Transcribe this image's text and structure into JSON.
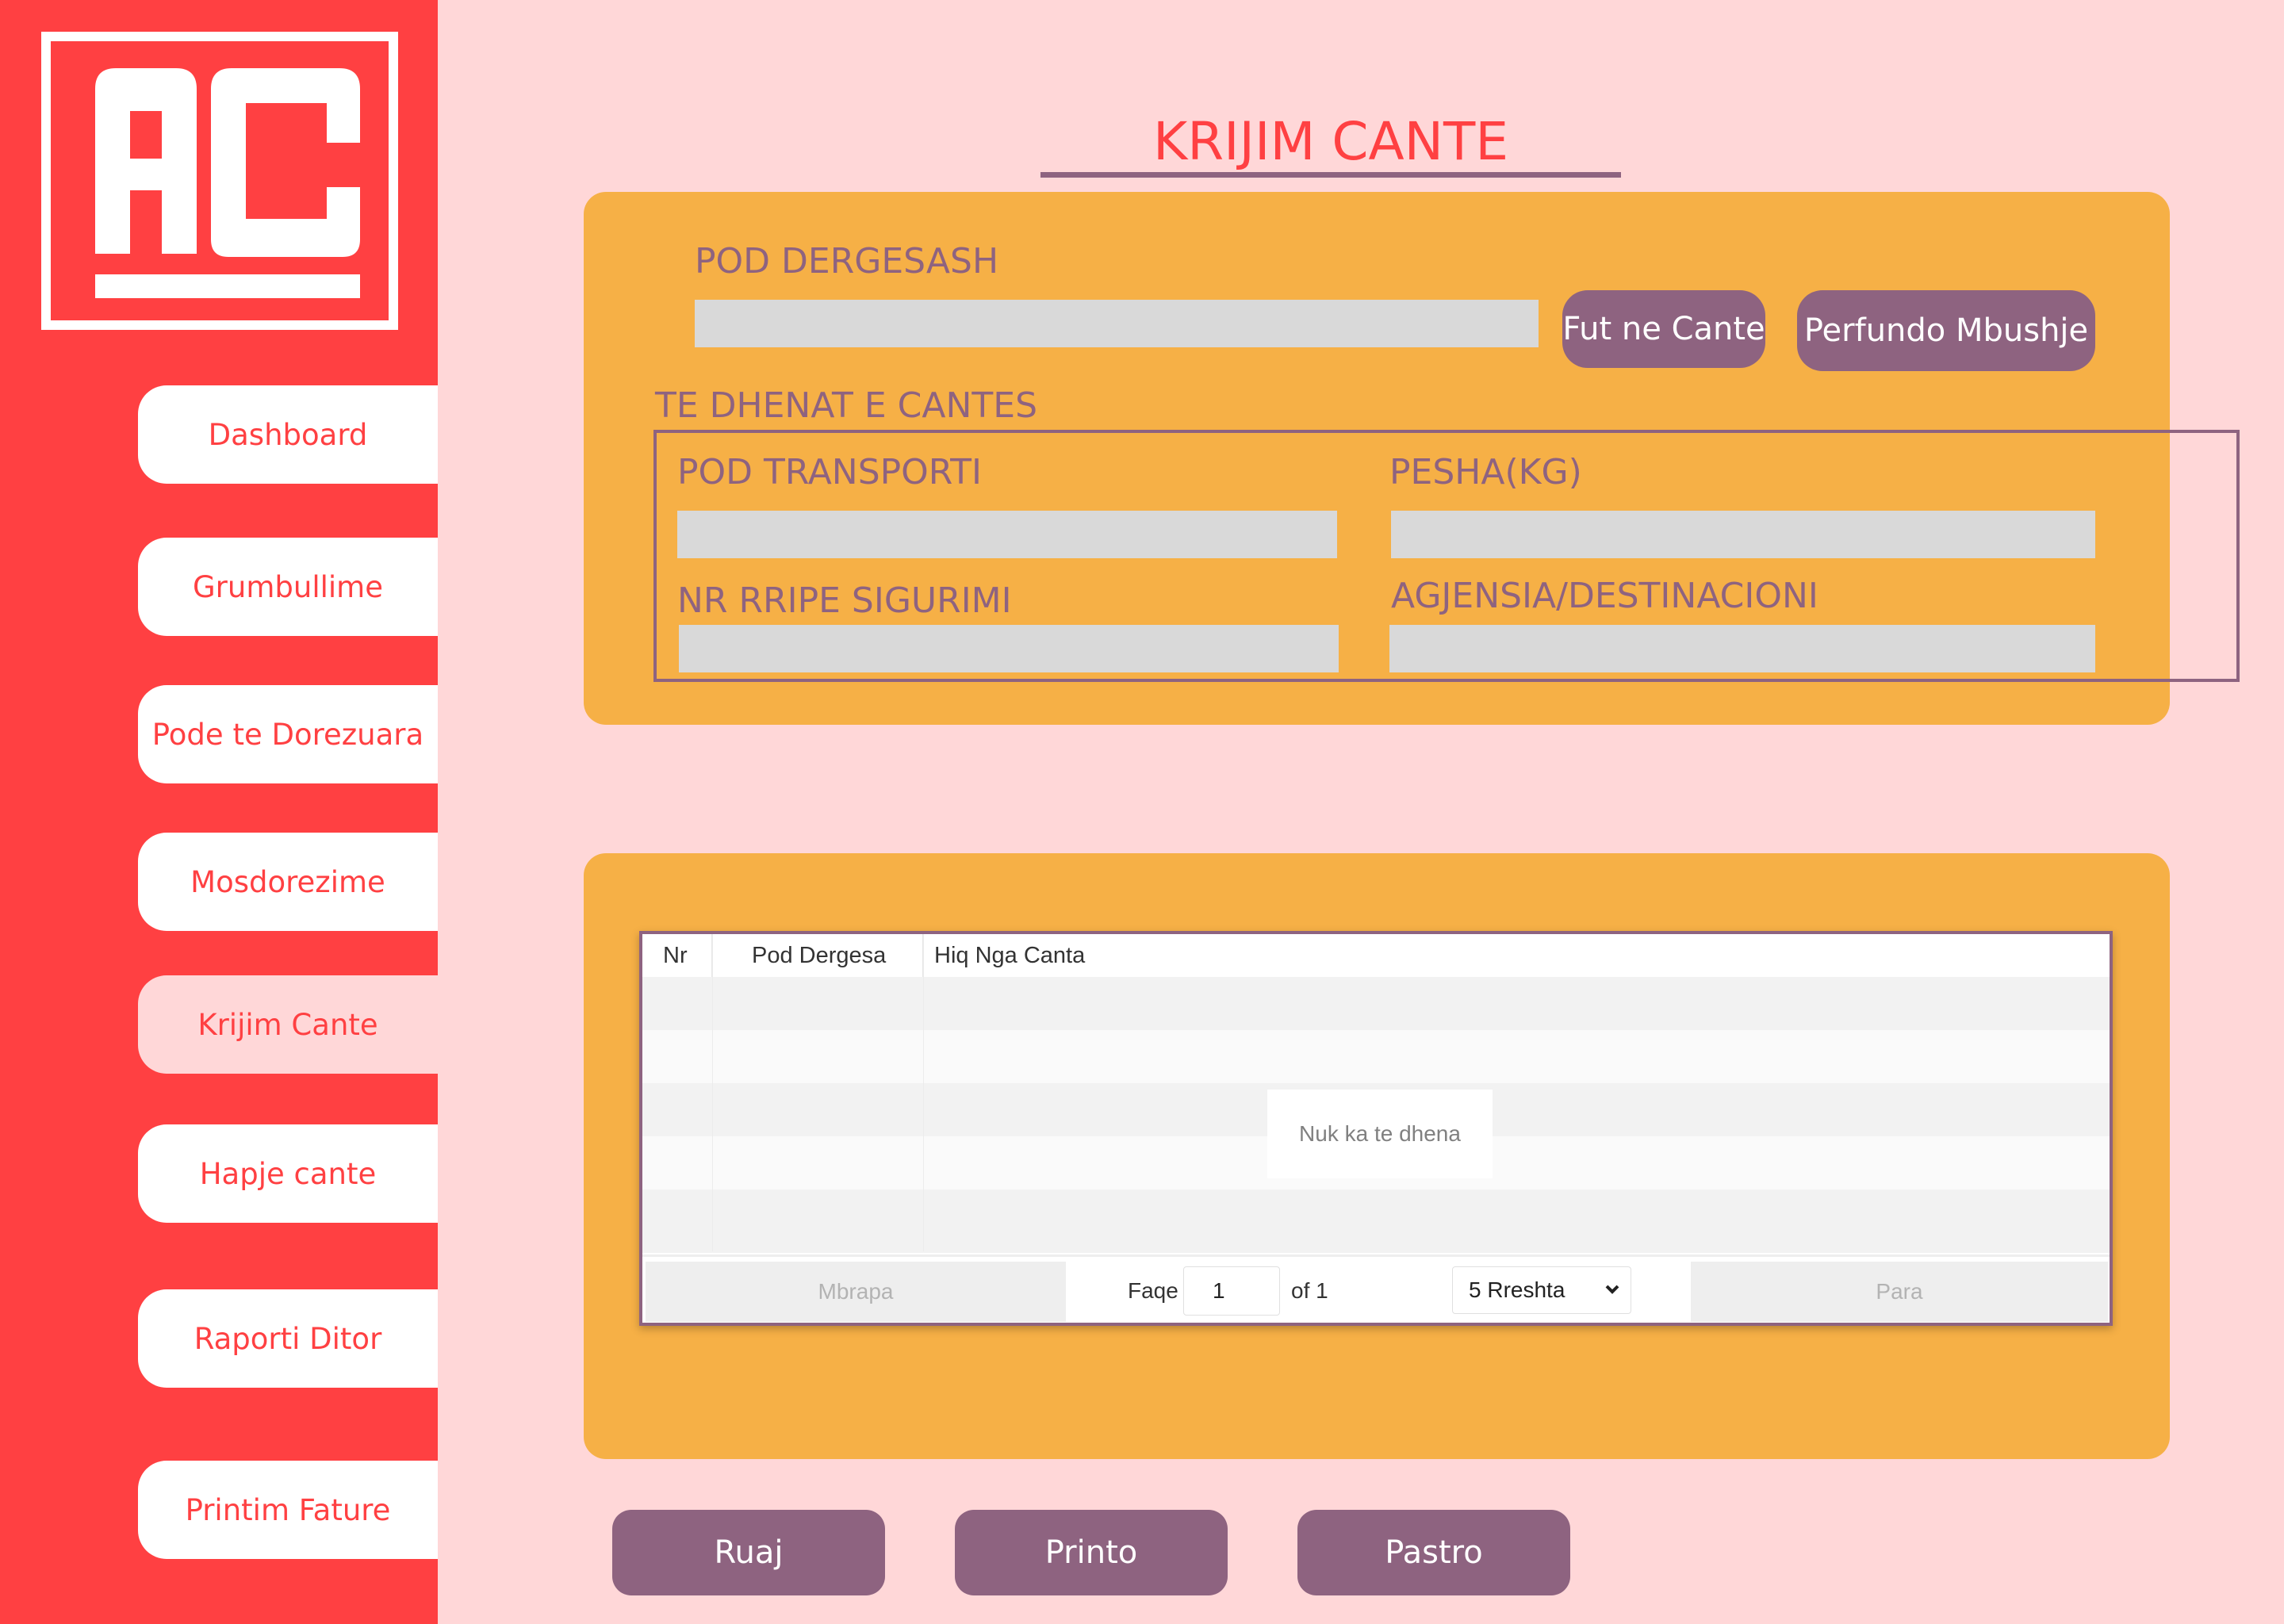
{
  "logo": {
    "text": "AC",
    "colors": {
      "background": "#ff4042",
      "mark": "#ffffff"
    }
  },
  "sidebar": {
    "items": [
      {
        "label": "Dashboard"
      },
      {
        "label": "Grumbullime"
      },
      {
        "label": "Pode te Dorezuara"
      },
      {
        "label": "Mosdorezime"
      },
      {
        "label": "Krijim Cante",
        "active": true
      },
      {
        "label": "Hapje cante"
      },
      {
        "label": "Raporti Ditor"
      },
      {
        "label": "Printim Fature"
      }
    ]
  },
  "page": {
    "title": "KRIJIM CANTE"
  },
  "form": {
    "pod_dergesash": {
      "label": "POD DERGESASH",
      "value": ""
    },
    "fut_ne_cante_label": "Fut ne Cante",
    "perfundo_mbushje_label": "Perfundo Mbushje",
    "section_label": "TE DHENAT E CANTES",
    "pod_transporti": {
      "label": "POD TRANSPORTI",
      "value": ""
    },
    "pesha": {
      "label": "PESHA(KG)",
      "value": ""
    },
    "nr_rripe": {
      "label": "NR RRIPE SIGURIMI",
      "value": ""
    },
    "agjensia": {
      "label": "AGJENSIA/DESTINACIONI",
      "value": ""
    }
  },
  "table": {
    "columns": [
      "Nr",
      "Pod Dergesa",
      "Hiq Nga Canta"
    ],
    "rows": [],
    "empty_text": "Nuk ka te dhena",
    "pagination": {
      "prev_label": "Mbrapa",
      "page_label": "Faqe",
      "page_value": "1",
      "of_label": "of 1",
      "rows_select": "5 Rreshta",
      "next_label": "Para"
    }
  },
  "actions": {
    "save_label": "Ruaj",
    "print_label": "Printo",
    "clear_label": "Pastro"
  },
  "colors": {
    "sidebar": "#ff4042",
    "page_background": "#ffd7d8",
    "card": "#f6b046",
    "accent_purple": "#8e6380",
    "input_gray": "#d9d9d9",
    "title_red": "#ff4042"
  }
}
